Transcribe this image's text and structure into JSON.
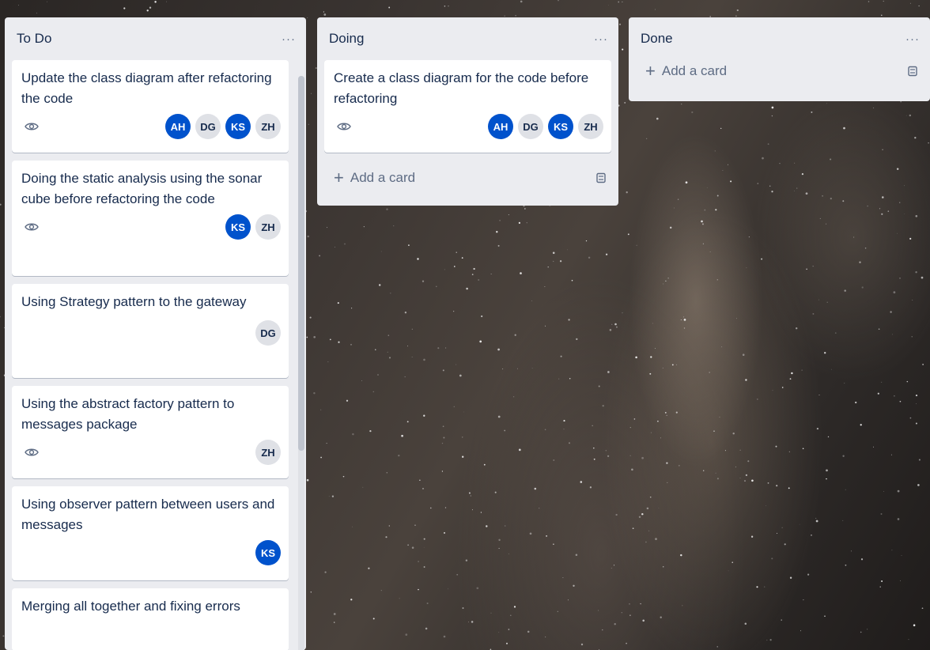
{
  "lists": [
    {
      "title": "To Do",
      "menu": "···",
      "cards": [
        {
          "title": "Update the class diagram after refactoring the code",
          "watch": true,
          "members": [
            {
              "initials": "AH",
              "color": "blue"
            },
            {
              "initials": "DG",
              "color": "grey"
            },
            {
              "initials": "KS",
              "color": "blue"
            },
            {
              "initials": "ZH",
              "color": "grey"
            }
          ]
        },
        {
          "title": "Doing the static analysis using the sonar cube before refactoring the code",
          "watch": true,
          "members": [
            {
              "initials": "KS",
              "color": "blue"
            },
            {
              "initials": "ZH",
              "color": "grey"
            }
          ]
        },
        {
          "title": "Using Strategy pattern to the gateway",
          "watch": false,
          "members": [
            {
              "initials": "DG",
              "color": "grey"
            }
          ]
        },
        {
          "title": "Using the abstract factory pattern to messages package",
          "watch": true,
          "members": [
            {
              "initials": "ZH",
              "color": "grey"
            }
          ]
        },
        {
          "title": "Using observer pattern between users and messages",
          "watch": false,
          "members": [
            {
              "initials": "KS",
              "color": "blue"
            }
          ]
        },
        {
          "title": "Merging all together and fixing errors",
          "watch": false,
          "members": []
        }
      ]
    },
    {
      "title": "Doing",
      "menu": "···",
      "add_label": "Add a card",
      "cards": [
        {
          "title": "Create a class diagram for the code before refactoring",
          "watch": true,
          "members": [
            {
              "initials": "AH",
              "color": "blue"
            },
            {
              "initials": "DG",
              "color": "grey"
            },
            {
              "initials": "KS",
              "color": "blue"
            },
            {
              "initials": "ZH",
              "color": "grey"
            }
          ]
        }
      ]
    },
    {
      "title": "Done",
      "menu": "···",
      "add_label": "Add a card",
      "cards": []
    }
  ],
  "colors": {
    "avatar_blue": "#0052cc",
    "avatar_grey": "#dfe1e6",
    "list_bg": "#ebecf0"
  }
}
